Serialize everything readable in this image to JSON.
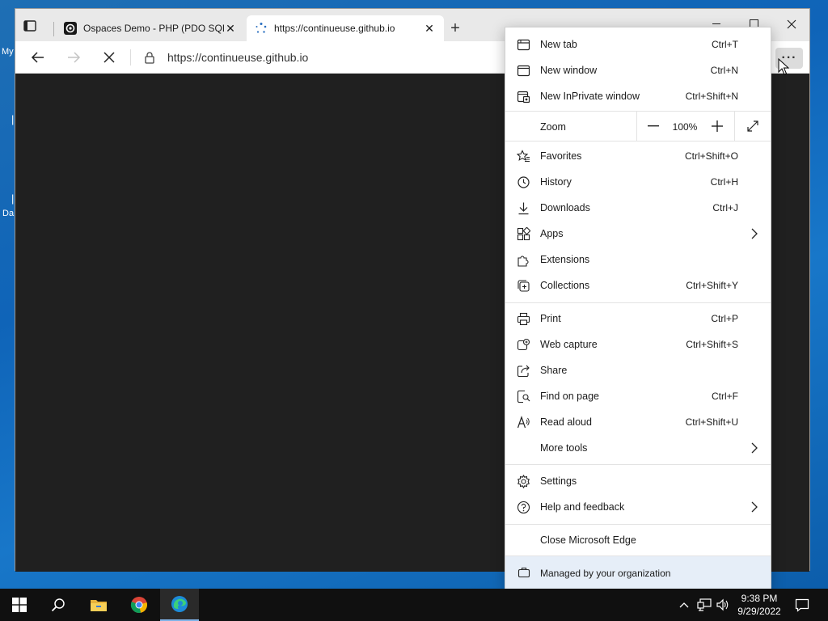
{
  "browser": {
    "tabs": [
      {
        "title": "Ospaces Demo - PHP (PDO SQL",
        "active": false
      },
      {
        "title": "https://continueuse.github.io",
        "active": true
      }
    ],
    "address": "https://continueuse.github.io"
  },
  "menu": {
    "items": [
      {
        "label": "New tab",
        "shortcut": "Ctrl+T",
        "icon": "new-tab-icon"
      },
      {
        "label": "New window",
        "shortcut": "Ctrl+N",
        "icon": "new-window-icon"
      },
      {
        "label": "New InPrivate window",
        "shortcut": "Ctrl+Shift+N",
        "icon": "inprivate-icon"
      },
      {
        "label": "Favorites",
        "shortcut": "Ctrl+Shift+O",
        "icon": "favorites-icon"
      },
      {
        "label": "History",
        "shortcut": "Ctrl+H",
        "icon": "history-icon"
      },
      {
        "label": "Downloads",
        "shortcut": "Ctrl+J",
        "icon": "downloads-icon"
      },
      {
        "label": "Apps",
        "shortcut": "",
        "icon": "apps-icon"
      },
      {
        "label": "Extensions",
        "shortcut": "",
        "icon": "extensions-icon"
      },
      {
        "label": "Collections",
        "shortcut": "Ctrl+Shift+Y",
        "icon": "collections-icon"
      },
      {
        "label": "Print",
        "shortcut": "Ctrl+P",
        "icon": "print-icon"
      },
      {
        "label": "Web capture",
        "shortcut": "Ctrl+Shift+S",
        "icon": "web-capture-icon"
      },
      {
        "label": "Share",
        "shortcut": "",
        "icon": "share-icon"
      },
      {
        "label": "Find on page",
        "shortcut": "Ctrl+F",
        "icon": "find-icon"
      },
      {
        "label": "Read aloud",
        "shortcut": "Ctrl+Shift+U",
        "icon": "read-aloud-icon"
      },
      {
        "label": "More tools",
        "shortcut": "",
        "icon": ""
      },
      {
        "label": "Settings",
        "shortcut": "",
        "icon": "settings-icon"
      },
      {
        "label": "Help and feedback",
        "shortcut": "",
        "icon": "help-icon"
      },
      {
        "label": "Close Microsoft Edge",
        "shortcut": "",
        "icon": ""
      }
    ],
    "zoom": {
      "label": "Zoom",
      "value": "100%"
    },
    "managed": "Managed by your organization"
  },
  "desktop": {
    "fragments": [
      "My",
      "Da"
    ]
  },
  "taskbar": {
    "time": "9:38 PM",
    "date": "9/29/2022"
  }
}
